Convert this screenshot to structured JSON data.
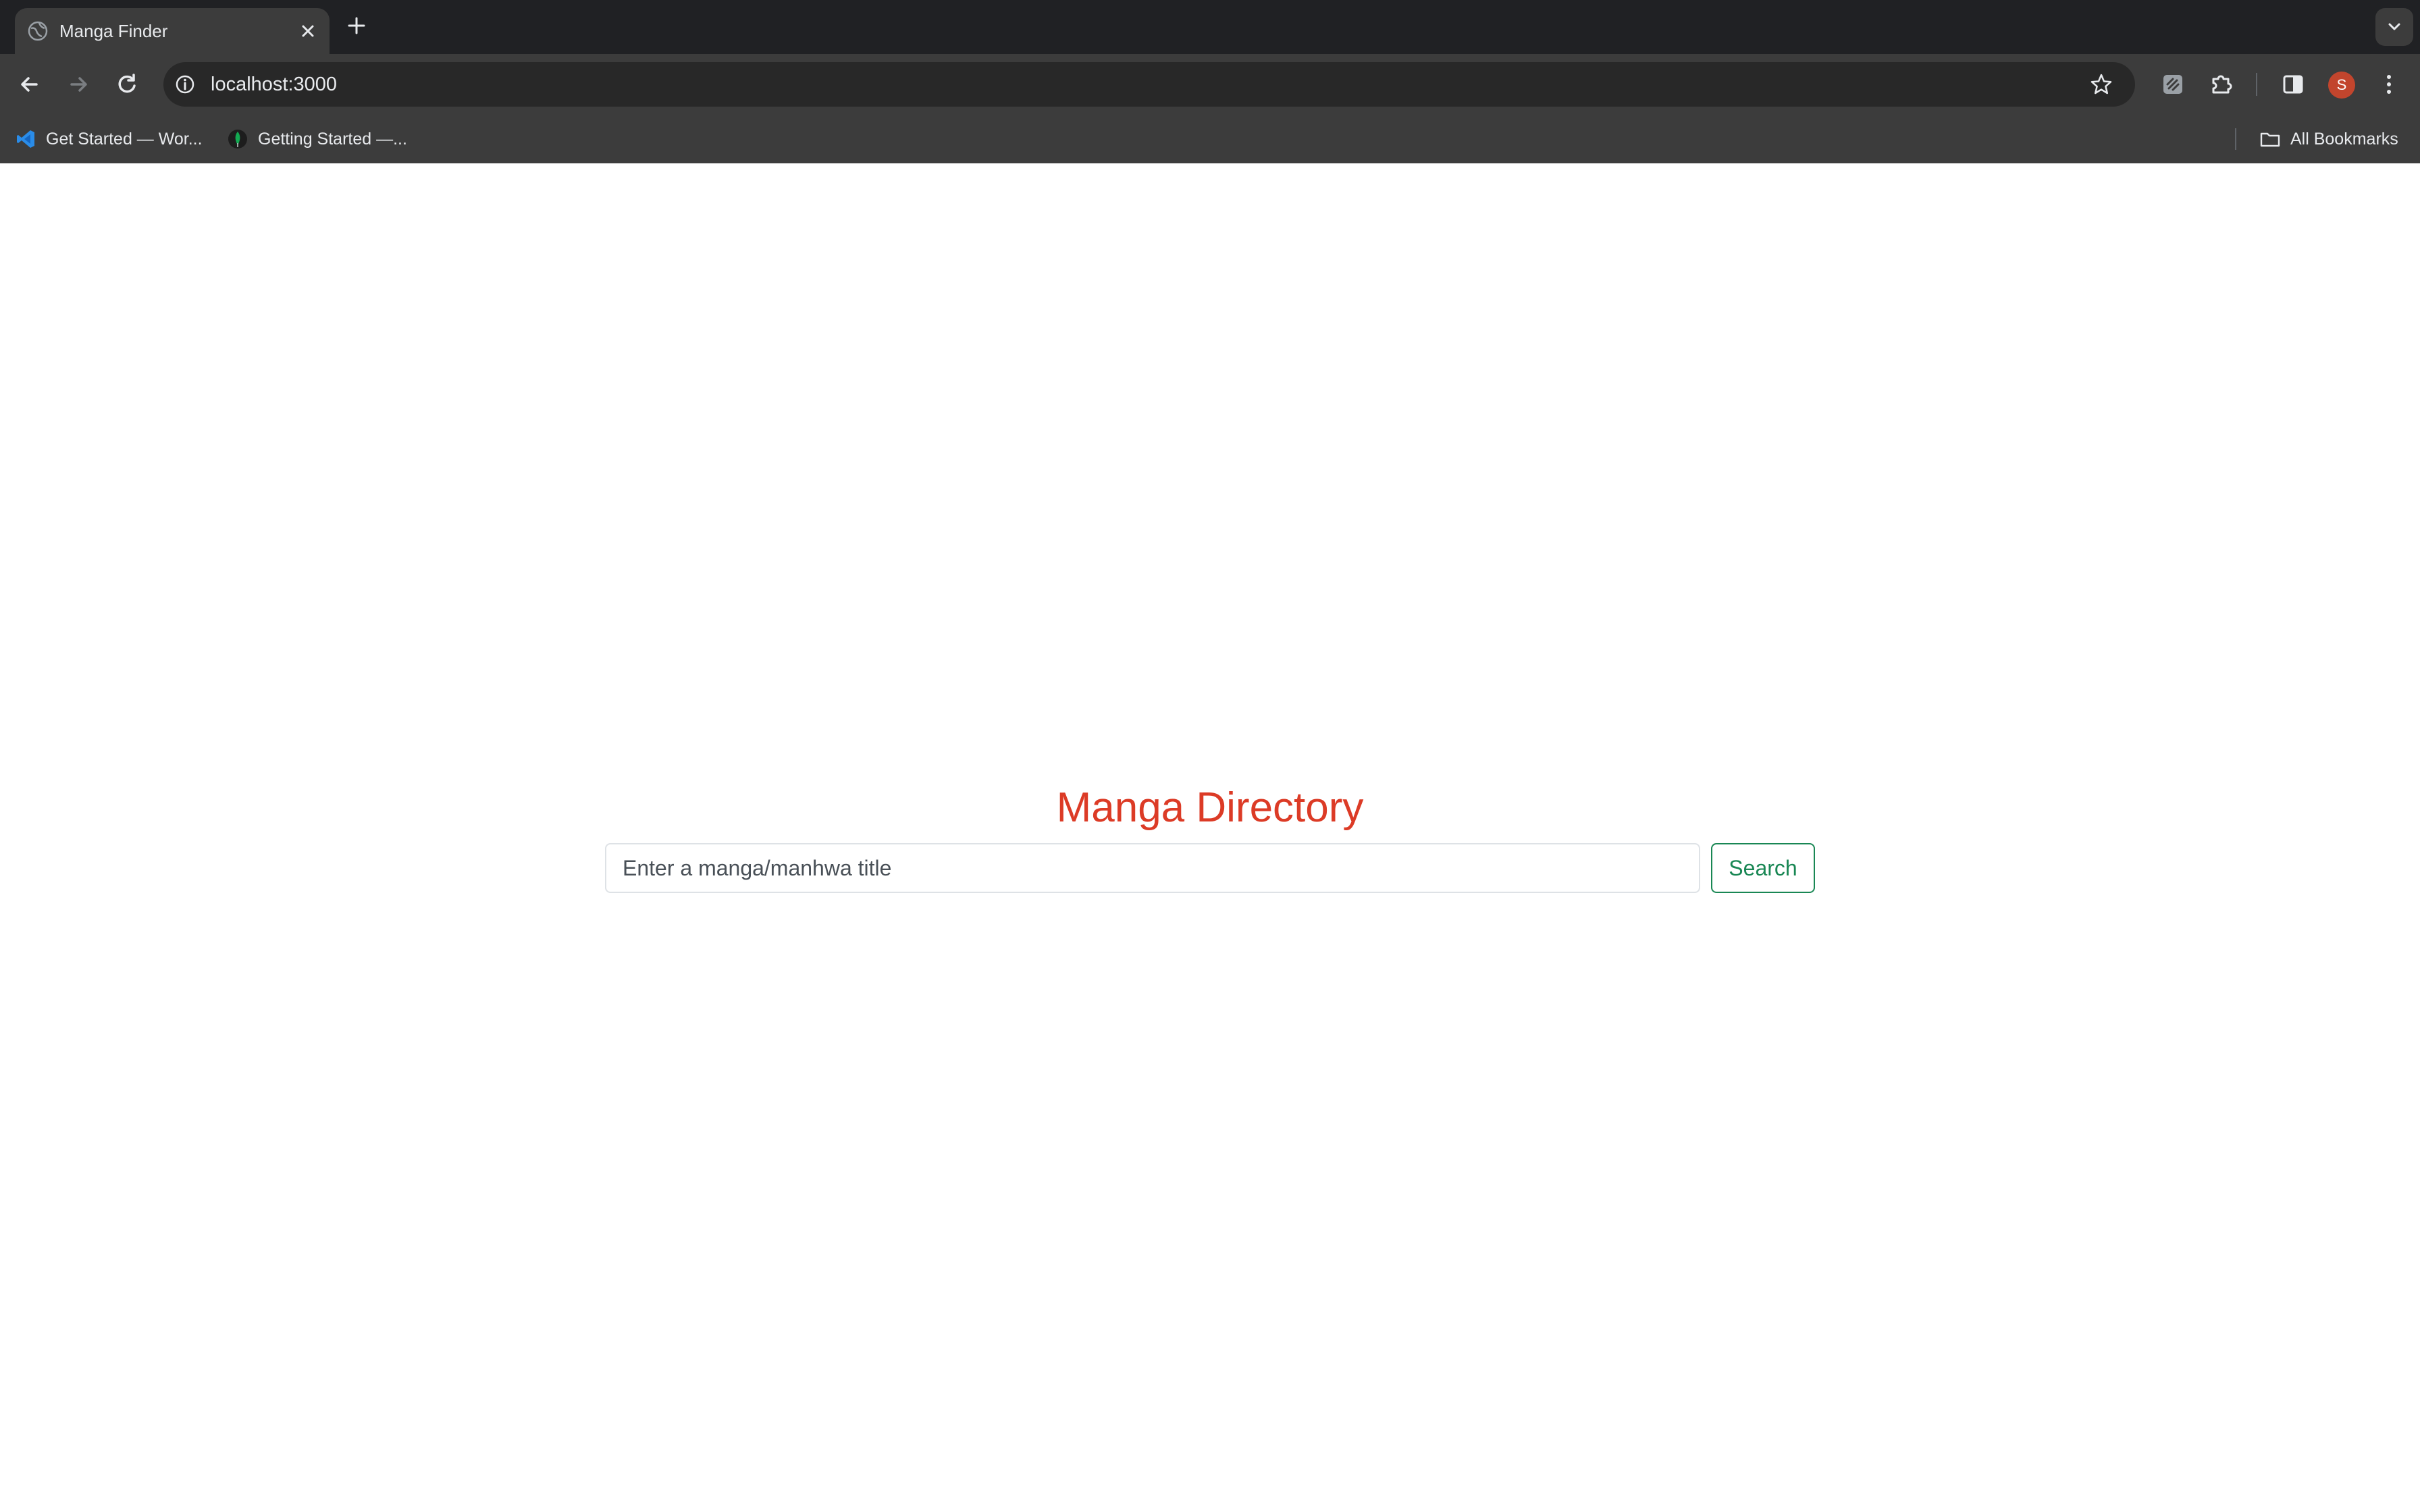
{
  "browser": {
    "tab": {
      "title": "Manga Finder"
    },
    "address_bar": {
      "url": "localhost:3000"
    },
    "profile_initial": "S",
    "bookmarks": [
      {
        "label": "Get Started — Wor...",
        "icon": "vscode-icon"
      },
      {
        "label": "Getting Started —...",
        "icon": "mongodb-leaf-icon"
      }
    ],
    "all_bookmarks_label": "All Bookmarks"
  },
  "page": {
    "heading": "Manga Directory",
    "search": {
      "placeholder": "Enter a manga/manhwa title",
      "value": "",
      "button_label": "Search"
    }
  },
  "colors": {
    "heading": "#dc3b26",
    "search_button": "#198754",
    "chrome_dark": "#202124",
    "chrome_toolbar": "#3c3c3c",
    "avatar": "#c2452d"
  }
}
